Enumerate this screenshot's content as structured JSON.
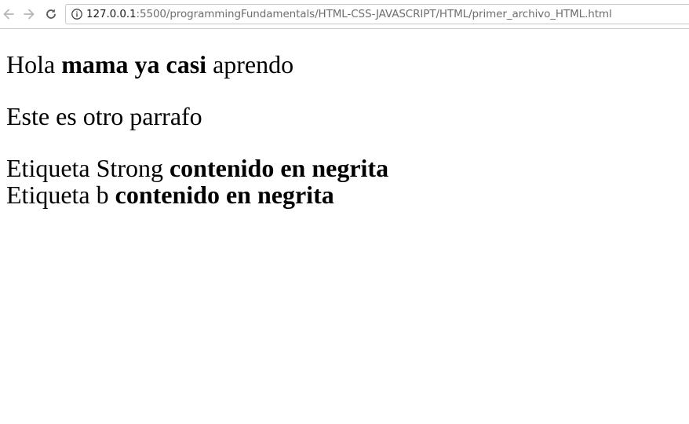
{
  "browser": {
    "url_host": "127.0.0.1",
    "url_rest": ":5500/programmingFundamentals/HTML-CSS-JAVASCRIPT/HTML/primer_archivo_HTML.html",
    "back_icon": "arrow-left-icon",
    "forward_icon": "arrow-right-icon",
    "reload_icon": "reload-icon",
    "info_icon": "info-circle-icon"
  },
  "document": {
    "paragraph1": {
      "before": "Hola",
      "bold": "mama ya casi",
      "after": "aprendo"
    },
    "paragraph2": {
      "text": "Este es otro parrafo"
    },
    "paragraph3": {
      "line1_label": "Etiqueta Strong",
      "line1_bold": "contenido en negrita",
      "line2_label": "Etiqueta b",
      "line2_bold": "contenido en negrita"
    }
  }
}
